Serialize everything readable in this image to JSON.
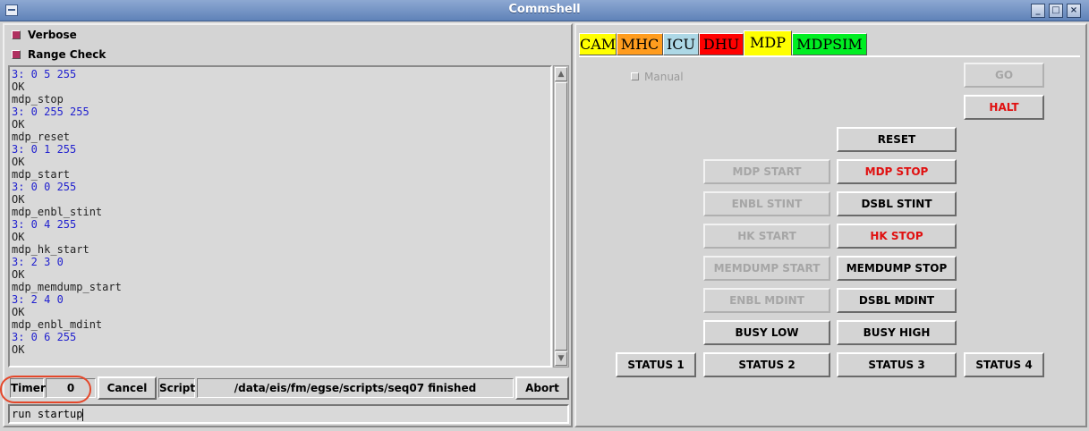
{
  "window": {
    "title": "Commshell"
  },
  "left": {
    "verbose_label": "Verbose",
    "range_check_label": "Range Check",
    "output_lines": [
      {
        "text": "3: 0 5 255",
        "kind": "resp"
      },
      {
        "text": "OK",
        "kind": "cmd"
      },
      {
        "text": "mdp_stop",
        "kind": "cmd"
      },
      {
        "text": "3: 0 255 255",
        "kind": "resp"
      },
      {
        "text": "OK",
        "kind": "cmd"
      },
      {
        "text": "mdp_reset",
        "kind": "cmd"
      },
      {
        "text": "3: 0 1 255",
        "kind": "resp"
      },
      {
        "text": "OK",
        "kind": "cmd"
      },
      {
        "text": "mdp_start",
        "kind": "cmd"
      },
      {
        "text": "3: 0 0 255",
        "kind": "resp"
      },
      {
        "text": "OK",
        "kind": "cmd"
      },
      {
        "text": "mdp_enbl_stint",
        "kind": "cmd"
      },
      {
        "text": "3: 0 4 255",
        "kind": "resp"
      },
      {
        "text": "OK",
        "kind": "cmd"
      },
      {
        "text": "mdp_hk_start",
        "kind": "cmd"
      },
      {
        "text": "3: 2 3 0",
        "kind": "resp"
      },
      {
        "text": "OK",
        "kind": "cmd"
      },
      {
        "text": "mdp_memdump_start",
        "kind": "cmd"
      },
      {
        "text": "3: 2 4 0",
        "kind": "resp"
      },
      {
        "text": "OK",
        "kind": "cmd"
      },
      {
        "text": "mdp_enbl_mdint",
        "kind": "cmd"
      },
      {
        "text": "3: 0 6 255",
        "kind": "resp"
      },
      {
        "text": "OK",
        "kind": "cmd"
      }
    ],
    "timer_label": "Timer",
    "timer_value": "0",
    "cancel_label": "Cancel",
    "script_label": "Script",
    "script_status": "/data/eis/fm/egse/scripts/seq07 finished",
    "abort_label": "Abort",
    "command_input": "run startup"
  },
  "tabs": [
    {
      "label": "CAM",
      "color": "#ffff00",
      "active": false
    },
    {
      "label": "MHC",
      "color": "#ff9c1e",
      "active": false
    },
    {
      "label": "ICU",
      "color": "#add8e6",
      "active": false
    },
    {
      "label": "DHU",
      "color": "#ff0000",
      "active": false
    },
    {
      "label": "MDP",
      "color": "#ffff00",
      "active": true
    },
    {
      "label": "MDPSIM",
      "color": "#00ee22",
      "active": false
    }
  ],
  "mdp": {
    "manual_label": "Manual",
    "go": "GO",
    "halt": "HALT",
    "reset": "RESET",
    "mdp_start": "MDP START",
    "mdp_stop": "MDP STOP",
    "enbl_stint": "ENBL STINT",
    "dsbl_stint": "DSBL STINT",
    "hk_start": "HK START",
    "hk_stop": "HK STOP",
    "memdump_start": "MEMDUMP START",
    "memdump_stop": "MEMDUMP STOP",
    "enbl_mdint": "ENBL MDINT",
    "dsbl_mdint": "DSBL MDINT",
    "busy_low": "BUSY LOW",
    "busy_high": "BUSY HIGH",
    "status1": "STATUS 1",
    "status2": "STATUS 2",
    "status3": "STATUS 3",
    "status4": "STATUS 4"
  },
  "colors": {
    "response_text": "#1f1fcf",
    "stop_text": "#e01010",
    "annotation": "#e4472a"
  }
}
